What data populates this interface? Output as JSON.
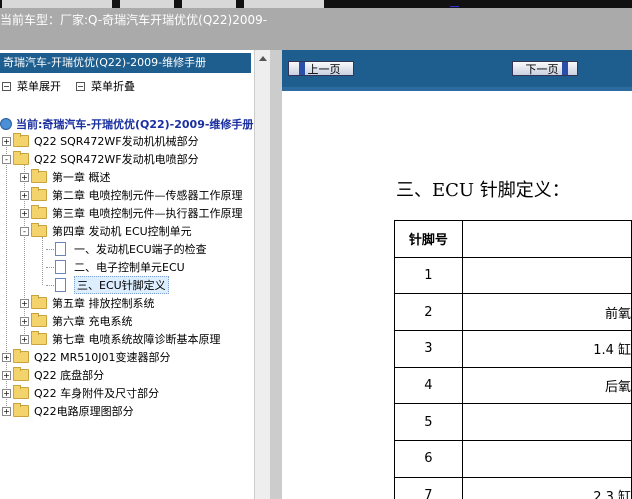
{
  "top_link": "__",
  "header": {
    "title": "当前车型：厂家:Q-奇瑞汽车开瑞优优(Q22)2009-"
  },
  "left_panel": {
    "title": "奇瑞汽车-开瑞优优(Q22)-2009-维修手册",
    "expand_label": "菜单展开",
    "collapse_label": "菜单折叠",
    "current_label": "当前:奇瑞汽车-开瑞优优(Q22)-2009-维修手册",
    "tree": [
      {
        "label": "Q22 SQR472WF发动机机械部分",
        "state": "+"
      },
      {
        "label": "Q22 SQR472WF发动机电喷部分",
        "state": "-"
      },
      {
        "label": "第一章 概述",
        "state": "+"
      },
      {
        "label": "第二章 电喷控制元件—传感器工作原理",
        "state": "+"
      },
      {
        "label": "第三章 电喷控制元件—执行器工作原理",
        "state": "+"
      },
      {
        "label": "第四章 发动机 ECU控制单元",
        "state": "-"
      },
      {
        "label": "一、发动机ECU端子的检查",
        "state": ""
      },
      {
        "label": "二、电子控制单元ECU",
        "state": ""
      },
      {
        "label": "三、ECU针脚定义",
        "state": ""
      },
      {
        "label": "第五章 排放控制系统",
        "state": "+"
      },
      {
        "label": "第六章 充电系统",
        "state": "+"
      },
      {
        "label": "第七章 电喷系统故障诊断基本原理",
        "state": "+"
      },
      {
        "label": "Q22 MR510J01变速器部分",
        "state": "+"
      },
      {
        "label": "Q22 底盘部分",
        "state": "+"
      },
      {
        "label": "Q22 车身附件及尺寸部分",
        "state": "+"
      },
      {
        "label": "Q22电路原理图部分",
        "state": "+"
      }
    ]
  },
  "nav": {
    "prev_label": "上一页",
    "next_label": "下一页"
  },
  "content": {
    "heading": "三、ECU 针脚定义：",
    "table_header": "针脚号",
    "rows": [
      {
        "pin": "1",
        "def": ""
      },
      {
        "pin": "2",
        "def": "前氧"
      },
      {
        "pin": "3",
        "def": "1.4 缸"
      },
      {
        "pin": "4",
        "def": "后氧"
      },
      {
        "pin": "5",
        "def": ""
      },
      {
        "pin": "6",
        "def": ""
      },
      {
        "pin": "7",
        "def": "2.3 缸"
      }
    ]
  },
  "colors": {
    "panel_blue": "#1d5e8f",
    "header_grey": "#aaaaaa",
    "current_text": "#1a2fa0"
  }
}
